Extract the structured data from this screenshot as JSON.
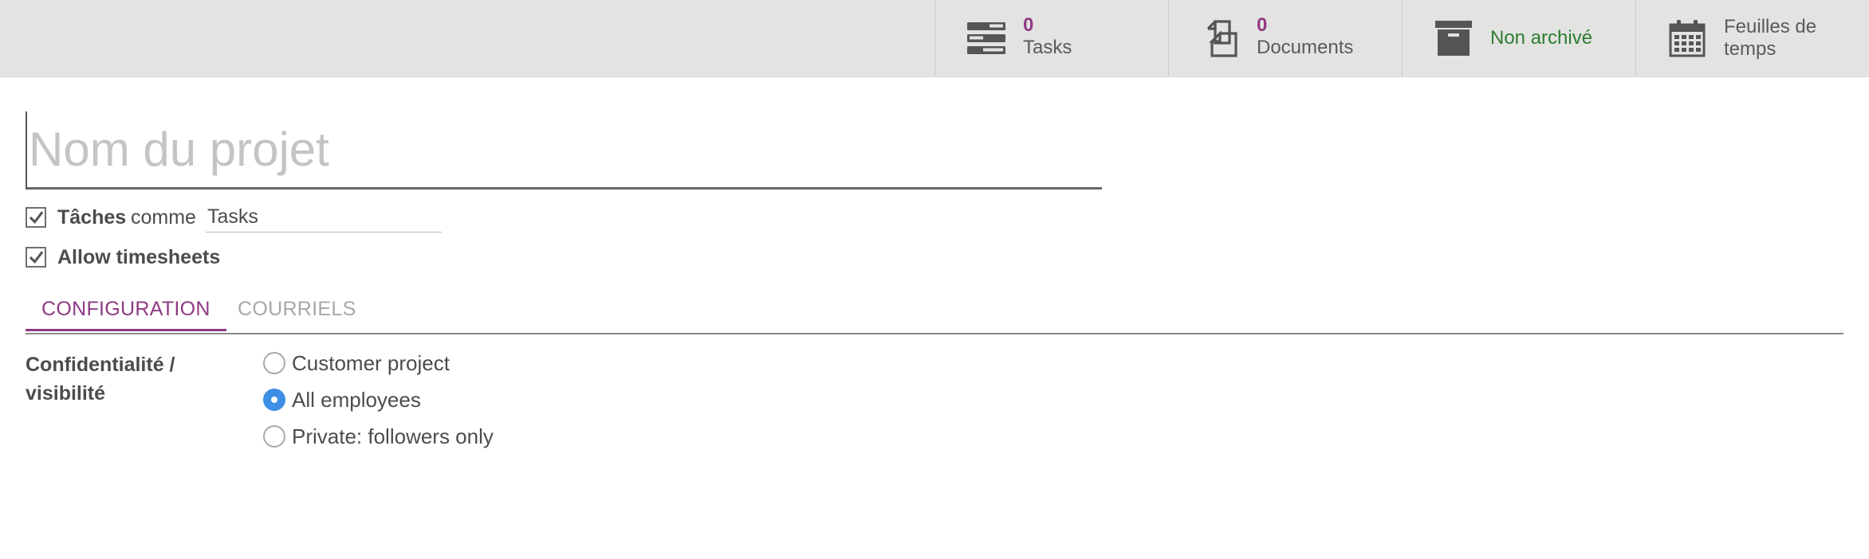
{
  "button_box": {
    "tasks": {
      "value": "0",
      "label": "Tasks",
      "icon": "tasks-icon"
    },
    "documents": {
      "value": "0",
      "label": "Documents",
      "icon": "documents-icon"
    },
    "archive": {
      "label": "Non archivé",
      "icon": "archive-icon"
    },
    "timesheets": {
      "label": "Feuilles de temps",
      "icon": "calendar-icon"
    }
  },
  "form": {
    "project_name_placeholder": "Nom du projet",
    "project_name_value": "",
    "tasks_checkbox": {
      "label": "Tâches",
      "checked": true
    },
    "comme_text": "comme",
    "alias_value": "Tasks",
    "timesheets_checkbox": {
      "label": "Allow timesheets",
      "checked": true
    }
  },
  "tabs": [
    {
      "label": "CONFIGURATION",
      "active": true
    },
    {
      "label": "COURRIELS",
      "active": false
    }
  ],
  "privacy": {
    "label": "Confidentialité / visibilité",
    "options": [
      {
        "label": "Customer project",
        "checked": false
      },
      {
        "label": "All employees",
        "checked": true
      },
      {
        "label": "Private: followers only",
        "checked": false
      }
    ]
  },
  "colors": {
    "accent": "#8f3a84",
    "archive_green": "#2e7d32",
    "radio_blue": "#3d8ee6",
    "topbar_bg": "#e3e3e2"
  }
}
